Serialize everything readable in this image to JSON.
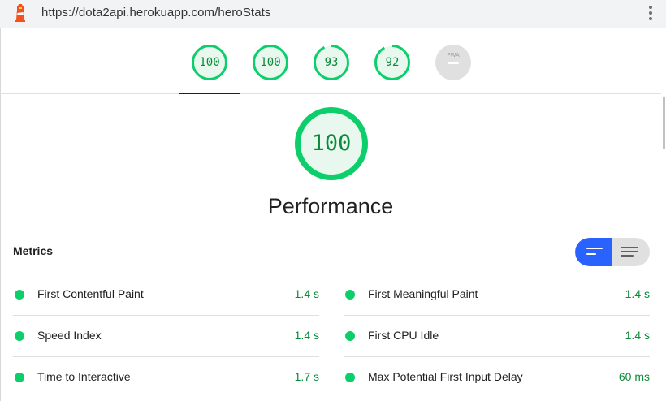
{
  "browser": {
    "url": "https://dota2api.herokuapp.com/heroStats"
  },
  "score_tabs": [
    {
      "score": "100",
      "fraction": 1.0
    },
    {
      "score": "100",
      "fraction": 1.0
    },
    {
      "score": "93",
      "fraction": 0.93
    },
    {
      "score": "92",
      "fraction": 0.92
    },
    {
      "label": "PWA"
    }
  ],
  "category": {
    "score": "100",
    "title": "Performance"
  },
  "metrics": {
    "title": "Metrics",
    "items": [
      {
        "name": "First Contentful Paint",
        "value": "1.4 s"
      },
      {
        "name": "First Meaningful Paint",
        "value": "1.4 s"
      },
      {
        "name": "Speed Index",
        "value": "1.4 s"
      },
      {
        "name": "First CPU Idle",
        "value": "1.4 s"
      },
      {
        "name": "Time to Interactive",
        "value": "1.7 s"
      },
      {
        "name": "Max Potential First Input Delay",
        "value": "60 ms"
      }
    ]
  },
  "colors": {
    "pass": "#0cce6b",
    "pass_text": "#0a8a3a",
    "accent": "#2962ff",
    "pwa_gray": "#e0e0e0"
  },
  "icons": {
    "app": "lighthouse-icon",
    "menu": "kebab-menu-icon",
    "view_expanded": "lines-icon",
    "view_collapsed": "list-icon"
  }
}
